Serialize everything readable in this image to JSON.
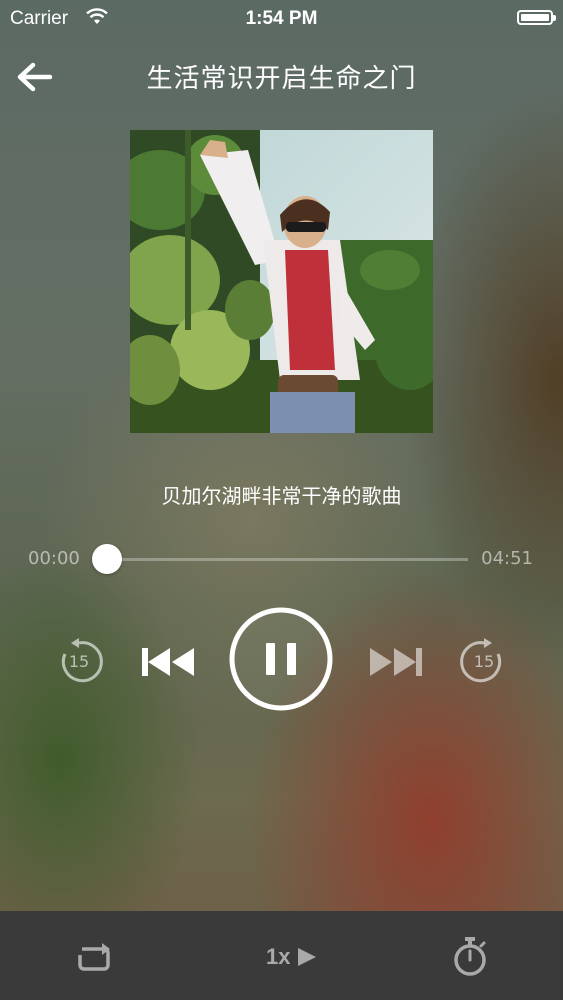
{
  "status_bar": {
    "carrier": "Carrier",
    "time": "1:54 PM"
  },
  "header": {
    "title": "生活常识开启生命之门"
  },
  "track": {
    "title": "贝加尔湖畔非常干净的歌曲"
  },
  "progress": {
    "current": "00:00",
    "total": "04:51",
    "fraction": 0.02
  },
  "controls": {
    "skip_back_seconds": "15",
    "skip_forward_seconds": "15",
    "state": "playing"
  },
  "bottom_bar": {
    "speed_label": "1x"
  },
  "colors": {
    "bottom_bar": "#3a3a3a",
    "inactive_icon": "#a9a9a9"
  },
  "icons": [
    "wifi-icon",
    "battery-icon",
    "back-arrow-icon",
    "replay-15-icon",
    "previous-track-icon",
    "pause-icon",
    "next-track-icon",
    "forward-15-icon",
    "loop-icon",
    "play-triangle-icon",
    "timer-icon"
  ]
}
